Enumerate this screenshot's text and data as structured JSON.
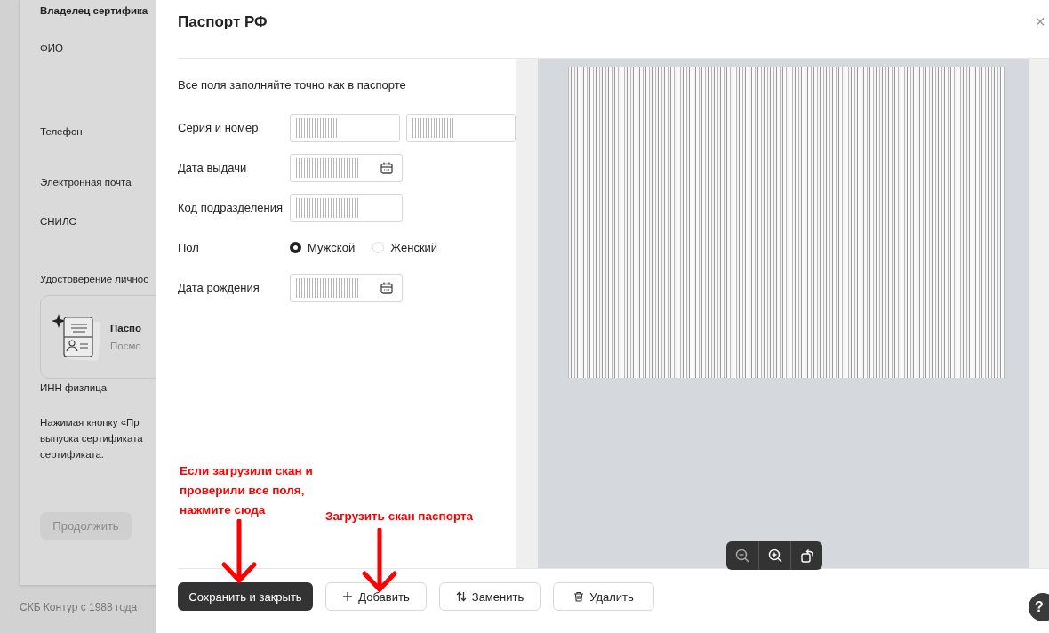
{
  "background_page": {
    "heading": "Владелец сертифика",
    "labels": [
      "ФИО",
      "Телефон",
      "Электронная почта",
      "СНИЛС"
    ],
    "id_section_label": "Удостоверение личнос",
    "document_card": {
      "title": "Паспо",
      "subtitle": "Посмо"
    },
    "inn_label": "ИНН физлица",
    "consent_lines": [
      "Нажимая кнопку «Пр",
      "выпуска сертификата",
      "сертификата."
    ],
    "continue_button": {
      "label": "Продолжить",
      "disabled": true
    },
    "footer": "СКБ Контур с 1988 года"
  },
  "modal": {
    "title": "Паспорт РФ",
    "close": "×",
    "intro": "Все поля заполняйте точно как в паспорте",
    "rows": [
      {
        "kind": "pair",
        "label": "Серия и номер"
      },
      {
        "kind": "date",
        "label": "Дата выдачи"
      },
      {
        "kind": "text",
        "label": "Код подразделения"
      },
      {
        "kind": "radio",
        "label": "Пол",
        "options": [
          {
            "label": "Мужской",
            "selected": true
          },
          {
            "label": "Женский",
            "selected": false
          }
        ]
      },
      {
        "kind": "date",
        "label": "Дата рождения"
      }
    ],
    "buttons": [
      {
        "kind": "primary",
        "label": "Сохранить и закрыть"
      },
      {
        "kind": "add",
        "label": "Добавить"
      },
      {
        "kind": "replace",
        "label": "Заменить"
      },
      {
        "kind": "delete",
        "label": "Удалить"
      }
    ]
  },
  "help_button": "?",
  "annotations": [
    {
      "text": "Если загрузили скан и проверили все поля, нажмите сюда"
    },
    {
      "text": "Загрузить скан паспорта"
    }
  ]
}
